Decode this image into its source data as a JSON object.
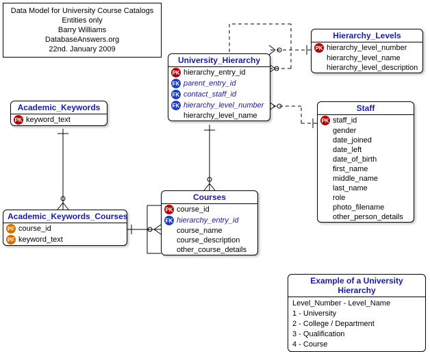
{
  "info": {
    "line1": "Data Model for University Course Catalogs",
    "line2": "Entities only",
    "line3": "Barry Williams",
    "line4": "DatabaseAnswers.org",
    "line5": "22nd. January 2009"
  },
  "entities": {
    "academic_keywords": {
      "title": "Academic_Keywords",
      "attrs": [
        {
          "badge": "PK",
          "name": "keyword_text"
        }
      ]
    },
    "academic_keywords_courses": {
      "title": "Academic_Keywords_Courses",
      "attrs": [
        {
          "badge": "PF",
          "name": "course_id"
        },
        {
          "badge": "PF",
          "name": "keyword_text"
        }
      ]
    },
    "university_hierarchy": {
      "title": "University_Hierarchy",
      "attrs": [
        {
          "badge": "PK",
          "name": "hierarchy_entry_id"
        },
        {
          "badge": "FK",
          "name": "parent_entry_id",
          "fk": true
        },
        {
          "badge": "FK",
          "name": "contact_staff_id",
          "fk": true
        },
        {
          "badge": "FK",
          "name": "hierarchy_level_number",
          "fk": true
        },
        {
          "badge": "",
          "name": "hierarchy_level_name"
        }
      ]
    },
    "hierarchy_levels": {
      "title": "Hierarchy_Levels",
      "attrs": [
        {
          "badge": "PK",
          "name": "hierarchy_level_number"
        },
        {
          "badge": "",
          "name": "hierarchy_level_name"
        },
        {
          "badge": "",
          "name": "hierarchy_level_description"
        }
      ]
    },
    "courses": {
      "title": "Courses",
      "attrs": [
        {
          "badge": "PK",
          "name": "course_id"
        },
        {
          "badge": "FK",
          "name": "hierarchy_entry_id",
          "fk": true
        },
        {
          "badge": "",
          "name": "course_name"
        },
        {
          "badge": "",
          "name": "course_description"
        },
        {
          "badge": "",
          "name": "other_course_details"
        }
      ]
    },
    "staff": {
      "title": "Staff",
      "attrs": [
        {
          "badge": "PK",
          "name": "staff_id"
        },
        {
          "badge": "",
          "name": "gender"
        },
        {
          "badge": "",
          "name": "date_joined"
        },
        {
          "badge": "",
          "name": "date_left"
        },
        {
          "badge": "",
          "name": "date_of_birth"
        },
        {
          "badge": "",
          "name": "first_name"
        },
        {
          "badge": "",
          "name": "middle_name"
        },
        {
          "badge": "",
          "name": "last_name"
        },
        {
          "badge": "",
          "name": "role"
        },
        {
          "badge": "",
          "name": "photo_filename"
        },
        {
          "badge": "",
          "name": "other_person_details"
        }
      ]
    }
  },
  "example": {
    "title": "Example of a University Hierarchy",
    "lines": [
      "Level_Number - Level_Name",
      "1 - University",
      "2 - College / Department",
      "3 - Qualification",
      "4 - Course"
    ]
  }
}
